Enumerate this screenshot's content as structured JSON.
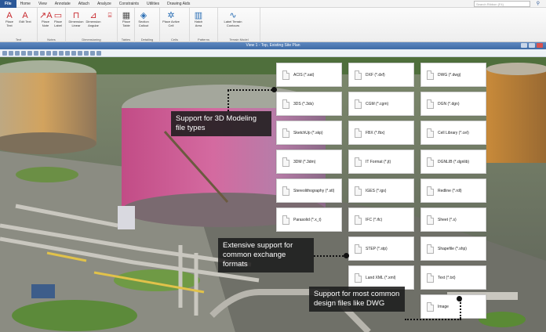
{
  "menu": {
    "file": "File",
    "items": [
      "Home",
      "View",
      "Annotate",
      "Attach",
      "Analyze",
      "Constraints",
      "Utilities",
      "Drawing Aids"
    ],
    "search_placeholder": "Search Ribbon (F4)"
  },
  "ribbon": {
    "groups": [
      {
        "label": "Text",
        "tools": [
          {
            "glyph": "A",
            "label": "Place Text"
          },
          {
            "glyph": "A",
            "label": "Edit Text"
          }
        ]
      },
      {
        "label": "Notes",
        "tools": [
          {
            "glyph": "↗A",
            "label": "Place Note"
          },
          {
            "glyph": "▭",
            "label": "Place Label"
          }
        ]
      },
      {
        "label": "Dimensioning",
        "tools": [
          {
            "glyph": "⊓",
            "label": "Dimension Linear"
          },
          {
            "glyph": "⊿",
            "label": "Dimension Angular"
          }
        ]
      },
      {
        "label": "Tables",
        "tools": [
          {
            "glyph": "▦",
            "label": "Place Table"
          }
        ]
      },
      {
        "label": "Detailing",
        "tools": [
          {
            "glyph": "◈",
            "label": "Section Callout"
          }
        ]
      },
      {
        "label": "Cells",
        "tools": [
          {
            "glyph": "✲",
            "label": "Place Active Cell"
          }
        ]
      },
      {
        "label": "Patterns",
        "tools": [
          {
            "glyph": "▥",
            "label": "Hatch Area"
          }
        ]
      },
      {
        "label": "Terrain Model",
        "tools": [
          {
            "glyph": "∿",
            "label": "Label Terrain Contours"
          }
        ]
      }
    ]
  },
  "view": {
    "title": "View 1 - Top, Existing Site Plan"
  },
  "file_types": [
    {
      "label": "ACIS (*.sat)"
    },
    {
      "label": "DXF (*.dxf)"
    },
    {
      "label": "DWG (*.dwg)"
    },
    {
      "label": "3DS (*.3ds)"
    },
    {
      "label": "CGM (*.cgm)"
    },
    {
      "label": "DGN (*.dgn)"
    },
    {
      "label": "SketchUp (*.skp)"
    },
    {
      "label": "FBX (*.fbx)"
    },
    {
      "label": "Cell Library (*.cel)"
    },
    {
      "label": "3DM (*.3dm)"
    },
    {
      "label": "IT Format (*.jt)"
    },
    {
      "label": "DGNLIB (*.dgnlib)"
    },
    {
      "label": "Stereolithography (*.stl)"
    },
    {
      "label": "IGES (*.igs)"
    },
    {
      "label": "Redline (*.rdl)"
    },
    {
      "label": "Parasolid (*.x_t)"
    },
    {
      "label": "IFC (*.ifc)"
    },
    {
      "label": "Sheet (*.s)"
    },
    {
      "label": "STEP (*.stp)"
    },
    {
      "label": "Shapefile (*.shp)"
    },
    {
      "label": "Land XML (*.xml)"
    },
    {
      "label": "Text (*.txt)"
    },
    {
      "label": "Image"
    }
  ],
  "callouts": {
    "modeling": "Support for 3D Modeling file types",
    "exchange": "Extensive support for common exchange formats",
    "design": "Support for most common design files like DWG"
  }
}
